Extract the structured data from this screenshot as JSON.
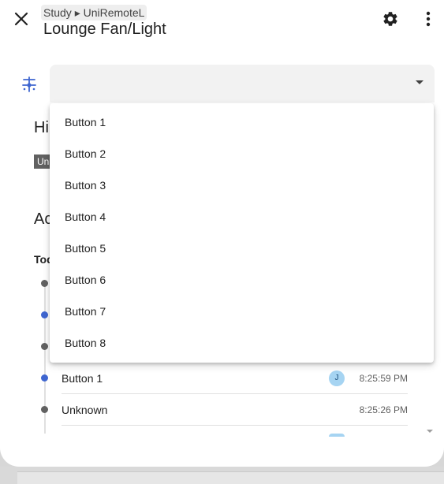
{
  "header": {
    "breadcrumb": "Study ▸ UniRemoteL",
    "title": "Lounge Fan/Light",
    "close_icon": "close-icon",
    "settings_icon": "gear-icon",
    "menu_icon": "more-vert-icon"
  },
  "entity": {
    "icon": "remote-button-icon",
    "icon_color": "#3f66d0",
    "select_value": ""
  },
  "background": {
    "history_heading_partial": "Hi",
    "history_chip_partial": "Un",
    "activity_heading_partial": "Ac",
    "today_label_partial": "Tod"
  },
  "activity": {
    "rows": [
      {
        "label": "Button 1",
        "avatar": "J",
        "time": "8:25:59 PM"
      },
      {
        "label": "Unknown",
        "avatar": "",
        "time": "8:25:26 PM"
      }
    ]
  },
  "dropdown": {
    "options": [
      "Button 1",
      "Button 2",
      "Button 3",
      "Button 4",
      "Button 5",
      "Button 6",
      "Button 7",
      "Button 8"
    ]
  },
  "colors": {
    "accent_blue": "#3f66d0",
    "grey_dot": "#616161",
    "avatar_bg": "#a6d4f2"
  }
}
